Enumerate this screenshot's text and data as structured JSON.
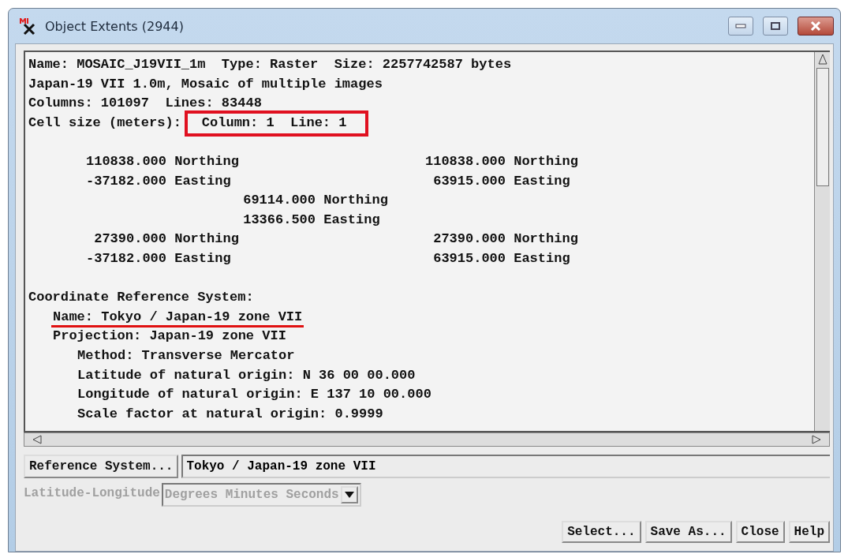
{
  "window": {
    "title": "Object Extents (2944)"
  },
  "report": {
    "header_lines": [
      "Name: MOSAIC_J19VII_1m  Type: Raster  Size: 2257742587 bytes",
      "Japan-19 VII 1.0m, Mosaic of multiple images",
      "Columns: 101097  Lines: 83448"
    ],
    "cell_size": {
      "label": "Cell size (meters):",
      "value": "Column: 1  Line: 1",
      "highlighted": true
    },
    "extents": {
      "top_left": [
        {
          "value": "110838.000",
          "unit": "Northing"
        },
        {
          "value": "-37182.000",
          "unit": "Easting"
        }
      ],
      "top_right": [
        {
          "value": "110838.000",
          "unit": "Northing"
        },
        {
          "value": "63915.000",
          "unit": "Easting"
        }
      ],
      "center": [
        {
          "value": "69114.000",
          "unit": "Northing"
        },
        {
          "value": "13366.500",
          "unit": "Easting"
        }
      ],
      "bottom_left": [
        {
          "value": "27390.000",
          "unit": "Northing"
        },
        {
          "value": "-37182.000",
          "unit": "Easting"
        }
      ],
      "bottom_right": [
        {
          "value": "27390.000",
          "unit": "Northing"
        },
        {
          "value": "63915.000",
          "unit": "Easting"
        }
      ]
    },
    "crs": {
      "text": "Coordinate Reference System:",
      "underlined": false,
      "children": [
        {
          "text": "Name: Tokyo / Japan-19 zone VII",
          "underlined": true
        },
        {
          "text": "Projection: Japan-19 zone VII",
          "underlined": false,
          "children": [
            {
              "text": "Method: Transverse Mercator",
              "underlined": false
            },
            {
              "text": "Latitude of natural origin: N 36 00 00.000",
              "underlined": false
            },
            {
              "text": "Longitude of natural origin: E 137 10 00.000",
              "underlined": false
            },
            {
              "text": "Scale factor at natural origin: 0.9999",
              "underlined": false
            }
          ]
        }
      ]
    }
  },
  "reference_system": {
    "button": "Reference System...",
    "value": "Tokyo / Japan-19 zone VII"
  },
  "format": {
    "label": "Latitude-Longitude",
    "value": "Degrees Minutes Seconds",
    "disabled": true
  },
  "buttons": [
    "Select...",
    "Save As...",
    "Close",
    "Help"
  ]
}
